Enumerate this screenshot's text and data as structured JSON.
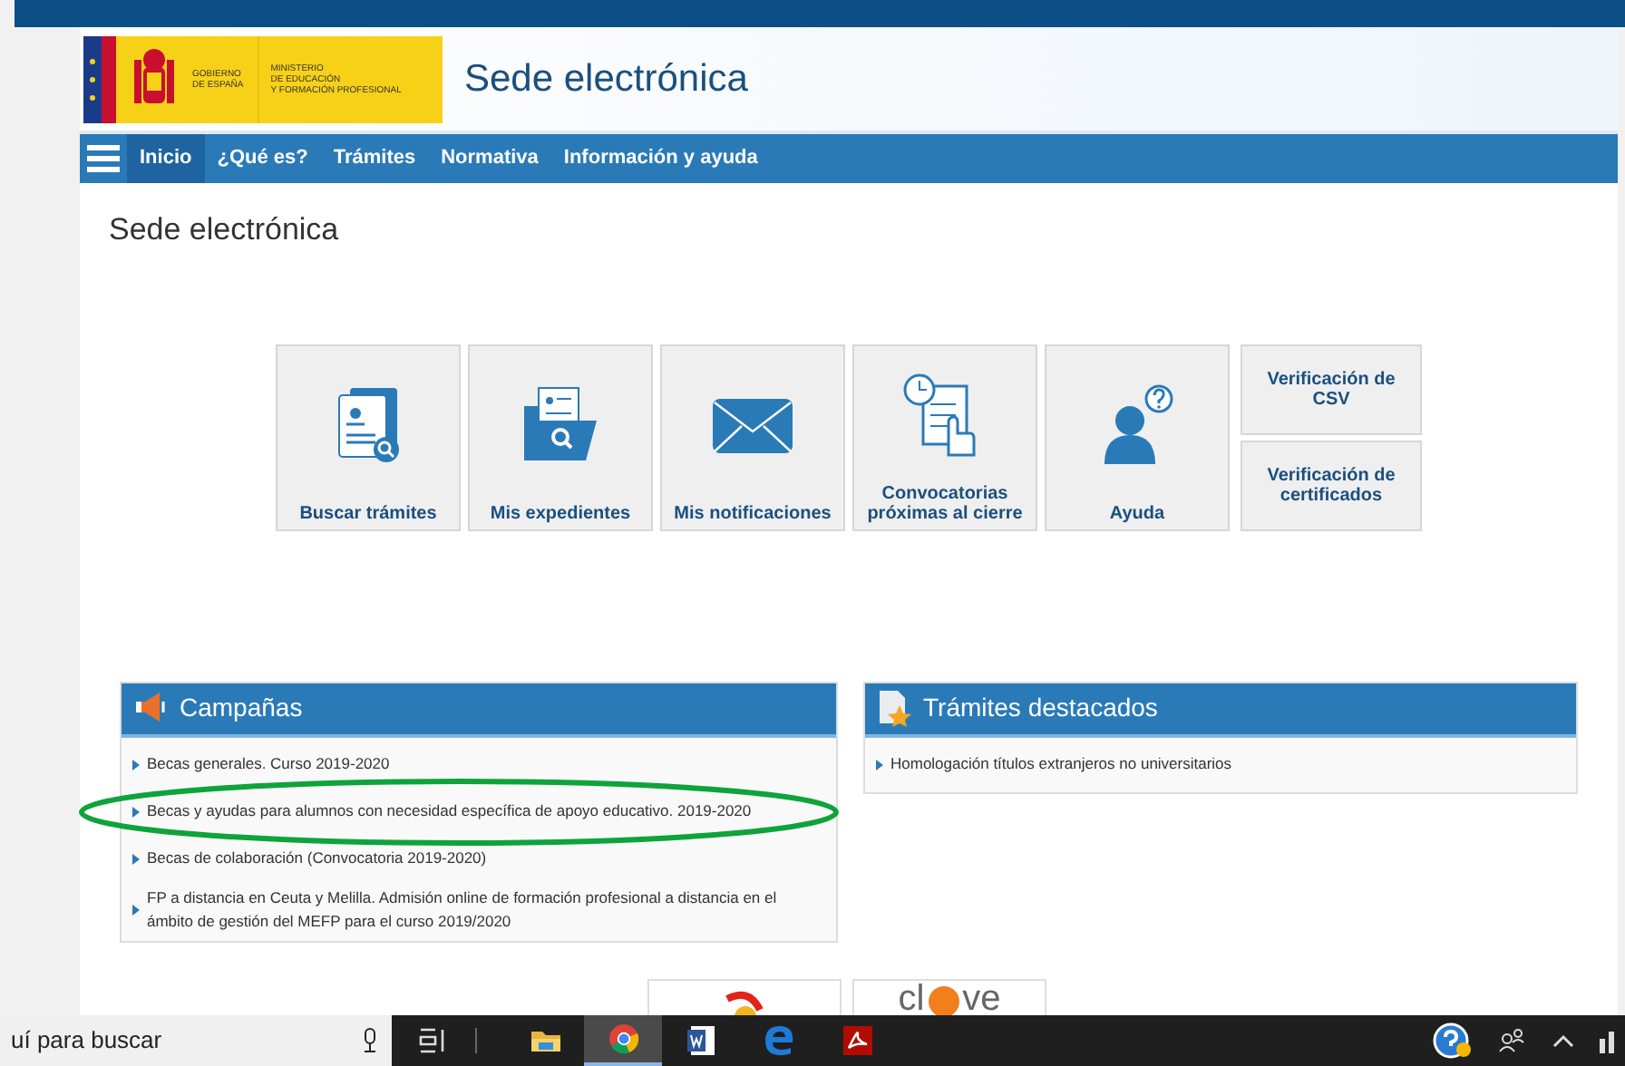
{
  "header": {
    "logo_left": [
      "GOBIERNO",
      "DE ESPAÑA"
    ],
    "logo_right": [
      "MINISTERIO",
      "DE EDUCACIÓN",
      "Y FORMACIÓN PROFESIONAL"
    ],
    "title": "Sede electrónica"
  },
  "nav": {
    "items": [
      {
        "label": "Inicio",
        "selected": true
      },
      {
        "label": "¿Qué es?",
        "selected": false
      },
      {
        "label": "Trámites",
        "selected": false
      },
      {
        "label": "Normativa",
        "selected": false
      },
      {
        "label": "Información y ayuda",
        "selected": false
      }
    ]
  },
  "page_title": "Sede electrónica",
  "tiles": [
    {
      "kind": "search-doc",
      "label": "Buscar trámites"
    },
    {
      "kind": "folder",
      "label": "Mis expedientes"
    },
    {
      "kind": "envelope",
      "label": "Mis notificaciones"
    },
    {
      "kind": "clock-doc",
      "label": "Convocatorias próximas al cierre"
    },
    {
      "kind": "person",
      "label": "Ayuda"
    }
  ],
  "side_tiles": [
    "Verificación de CSV",
    "Verificación de certificados"
  ],
  "panels": [
    {
      "kind": "megaphone",
      "title": "Campañas",
      "links": [
        {
          "text": "Becas generales. Curso 2019-2020",
          "highlighted": false
        },
        {
          "text": "Becas y ayudas para alumnos con necesidad específica de apoyo educativo. 2019-2020",
          "highlighted": true
        },
        {
          "text": "Becas de colaboración (Convocatoria 2019-2020)",
          "highlighted": false
        },
        {
          "text": "FP a distancia en Ceuta y Melilla. Admisión online de formación profesional a distancia en el ámbito de gestión del MEFP para el curso 2019/2020",
          "highlighted": false
        }
      ]
    },
    {
      "kind": "star",
      "title": "Trámites destacados",
      "links": [
        {
          "text": "Homologación títulos extranjeros no universitarios",
          "highlighted": false
        }
      ]
    }
  ],
  "footer_logos": {
    "clave": [
      "cl",
      "ve"
    ]
  },
  "taskbar": {
    "search": "uí para buscar",
    "apps": [
      {
        "kind": "folder",
        "selected": false
      },
      {
        "kind": "chrome",
        "selected": true
      },
      {
        "kind": "word",
        "selected": false
      },
      {
        "kind": "edge",
        "selected": false
      },
      {
        "kind": "pdf",
        "selected": false
      }
    ]
  }
}
